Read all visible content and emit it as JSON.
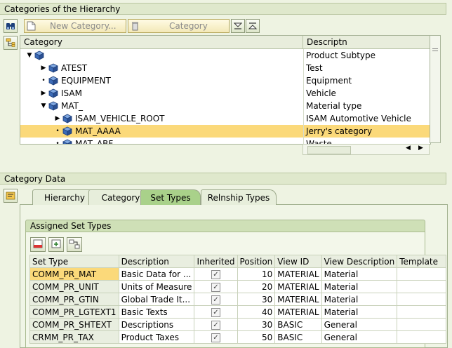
{
  "hierarchy": {
    "title": "Categories of the Hierarchy",
    "toolbar": {
      "new_category_label": "New Category...",
      "category_label": "Category"
    },
    "columns": {
      "category": "Category",
      "description": "Descriptn"
    },
    "rows": [
      {
        "label": "",
        "desc": "Product Subtype",
        "level": 0,
        "expand": "open"
      },
      {
        "label": "ATEST",
        "desc": "Test",
        "level": 1,
        "expand": "closed"
      },
      {
        "label": "EQUIPMENT",
        "desc": "Equipment",
        "level": 1,
        "expand": "dot"
      },
      {
        "label": "ISAM",
        "desc": "Vehicle",
        "level": 1,
        "expand": "closed"
      },
      {
        "label": "MAT_",
        "desc": "Material type",
        "level": 1,
        "expand": "open"
      },
      {
        "label": "ISAM_VEHICLE_ROOT",
        "desc": "ISAM Automotive Vehicle",
        "level": 2,
        "expand": "closed"
      },
      {
        "label": "MAT_AAAA",
        "desc": "Jerry's category",
        "level": 2,
        "expand": "dot",
        "selected": true
      },
      {
        "label": "MAT_ABF",
        "desc": "Waste",
        "level": 2,
        "expand": "dot"
      }
    ]
  },
  "category_data": {
    "title": "Category Data",
    "tabs": [
      {
        "label": "Hierarchy"
      },
      {
        "label": "Category"
      },
      {
        "label": "Set Types",
        "active": true
      },
      {
        "label": "Relnship Types"
      }
    ],
    "assigned_set_types": {
      "title": "Assigned Set Types",
      "columns": [
        "Set Type",
        "Description",
        "Inherited",
        "Position",
        "View ID",
        "View Description",
        "Template"
      ],
      "rows": [
        {
          "set_type": "COMM_PR_MAT",
          "description": "Basic Data for ...",
          "inherited": true,
          "position": "10",
          "view_id": "MATERIAL",
          "view_desc": "Material",
          "template": ""
        },
        {
          "set_type": "COMM_PR_UNIT",
          "description": "Units of Measure",
          "inherited": true,
          "position": "20",
          "view_id": "MATERIAL",
          "view_desc": "Material",
          "template": ""
        },
        {
          "set_type": "COMM_PR_GTIN",
          "description": "Global Trade It...",
          "inherited": true,
          "position": "30",
          "view_id": "MATERIAL",
          "view_desc": "Material",
          "template": ""
        },
        {
          "set_type": "COMM_PR_LGTEXT1",
          "description": "Basic Texts",
          "inherited": true,
          "position": "40",
          "view_id": "MATERIAL",
          "view_desc": "Material",
          "template": ""
        },
        {
          "set_type": "COMM_PR_SHTEXT",
          "description": "Descriptions",
          "inherited": true,
          "position": "30",
          "view_id": "BASIC",
          "view_desc": "General",
          "template": ""
        },
        {
          "set_type": "CRMM_PR_TAX",
          "description": "Product Taxes",
          "inherited": true,
          "position": "50",
          "view_id": "BASIC",
          "view_desc": "General",
          "template": ""
        }
      ]
    }
  },
  "icons": {
    "hierarchy_button": "binoculars-icon",
    "side_button": "tree-structure-icon",
    "category_data_button": "detail-panel-icon",
    "collapse_all": "collapse-all-icon",
    "expand_all": "expand-all-icon",
    "node": "cube-icon"
  },
  "colors": {
    "selection": "#fbd97a",
    "active_tab": "#a9d18a",
    "panel_bg": "#eef3e2"
  }
}
